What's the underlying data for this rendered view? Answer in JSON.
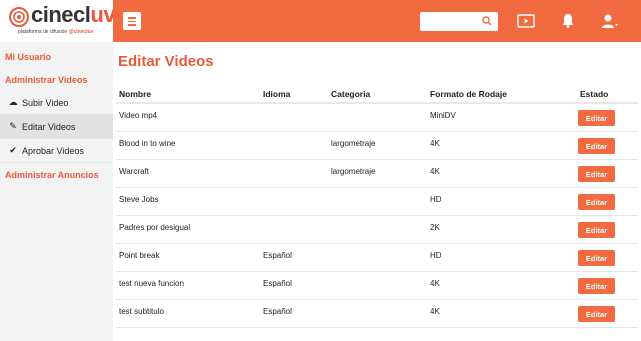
{
  "brand": {
    "name_main": "cinecl",
    "name_accent": "uv",
    "tagline": "plataforma de difusión",
    "tagline_brand": "@cinecluv"
  },
  "header": {
    "search": {
      "value": "",
      "placeholder": ""
    },
    "icons": [
      "menu-icon",
      "search-icon",
      "video-player-icon",
      "bell-icon",
      "user-icon"
    ],
    "accent_color": "#f26a3f"
  },
  "sidebar": {
    "my_user": "Mi Usuario",
    "admin_videos": "Administrar Videos",
    "items": [
      {
        "label": "Subir Video",
        "icon": "upload-icon"
      },
      {
        "label": "Editar Videos",
        "icon": "pencil-icon",
        "active": true
      },
      {
        "label": "Aprobar Videos",
        "icon": "check-icon"
      }
    ],
    "admin_ads": "Administrar Anuncios"
  },
  "main": {
    "title": "Editar Videos",
    "columns": [
      "Nombre",
      "Idioma",
      "Categoria",
      "Formato de Rodaje",
      "Estado"
    ],
    "edit_label": "Editar",
    "rows": [
      {
        "name": "Video mp4",
        "language": "",
        "category": "",
        "format": "MiniDV"
      },
      {
        "name": "Blood in to wine",
        "language": "",
        "category": "largometraje",
        "format": "4K"
      },
      {
        "name": "Warcraft",
        "language": "",
        "category": "largometraje",
        "format": "4K"
      },
      {
        "name": "Steve Jobs",
        "language": "",
        "category": "",
        "format": "HD"
      },
      {
        "name": "Padres por desigual",
        "language": "",
        "category": "",
        "format": "2K"
      },
      {
        "name": "Point break",
        "language": "Español",
        "category": "",
        "format": "HD"
      },
      {
        "name": "test nueva funcion",
        "language": "Español",
        "category": "",
        "format": "4K"
      },
      {
        "name": "test subtitulo",
        "language": "Español",
        "category": "",
        "format": "4K"
      }
    ]
  }
}
